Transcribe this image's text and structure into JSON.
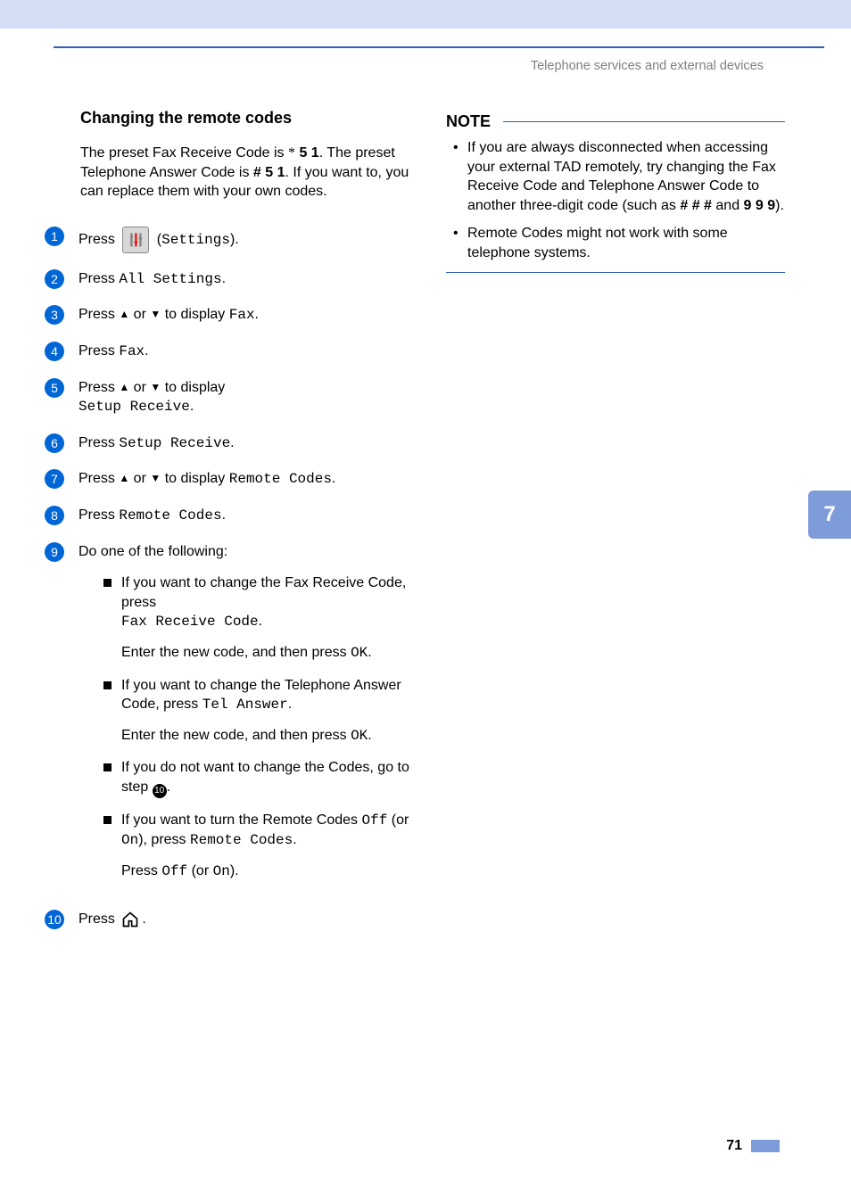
{
  "header": {
    "breadcrumb": "Telephone services and external devices"
  },
  "section": {
    "title": "Changing the remote codes",
    "intro_pre": "The preset Fax Receive Code is ",
    "intro_code1": "5 1",
    "intro_mid": ". The preset Telephone Answer Code is ",
    "intro_code2": "# 5 1",
    "intro_post": ". If you want to, you can replace them with your own codes."
  },
  "steps": {
    "s1_pre": "Press ",
    "s1_label": "Settings",
    "s2_pre": "Press ",
    "s2_label": "All Settings",
    "s3_pre": "Press ",
    "s3_post": " to display ",
    "s3_target": "Fax",
    "s4_pre": "Press ",
    "s4_target": "Fax",
    "s5_pre": "Press ",
    "s5_post": " to display",
    "s5_target": "Setup Receive",
    "s6_pre": "Press ",
    "s6_target": "Setup Receive",
    "s7_pre": "Press ",
    "s7_post": " to display ",
    "s7_target": "Remote Codes",
    "s8_pre": "Press ",
    "s8_target": "Remote Codes",
    "s9_text": "Do one of the following:",
    "s10_pre": "Press "
  },
  "sub": {
    "a1": "If you want to change the Fax Receive Code, press",
    "a1_code": "Fax Receive Code",
    "a2_pre": "Enter the new code, and then press ",
    "a2_code": "OK",
    "b1_pre": "If you want to change the Telephone Answer Code, press ",
    "b1_code": "Tel Answer",
    "b2_pre": "Enter the new code, and then press ",
    "b2_code": "OK",
    "c1_pre": "If you do not want to change the Codes, go to step ",
    "c1_ref": "⓾",
    "d1_pre": "If you want to turn the Remote Codes ",
    "d1_off": "Off",
    "d1_mid": " (or ",
    "d1_on": "On",
    "d1_post": "), press ",
    "d1_code": "Remote Codes",
    "d2_pre": "Press ",
    "d2_off": "Off",
    "d2_mid": " (or ",
    "d2_on": "On",
    "d2_post": ")."
  },
  "arrows": {
    "up": "▲",
    "down": "▼",
    "or": " or "
  },
  "note": {
    "title": "NOTE",
    "item1_pre": "If you are always disconnected when accessing your external TAD remotely, try changing the Fax Receive Code and Telephone Answer Code to another three-digit code (such as ",
    "item1_c1": "# # #",
    "item1_mid": " and ",
    "item1_c2": "9 9 9",
    "item1_post": ").",
    "item2": "Remote Codes might not work with some telephone systems."
  },
  "sidebar": {
    "chapter": "7"
  },
  "footer": {
    "page": "71"
  },
  "step_numbers": [
    "1",
    "2",
    "3",
    "4",
    "5",
    "6",
    "7",
    "8",
    "9",
    "10"
  ]
}
